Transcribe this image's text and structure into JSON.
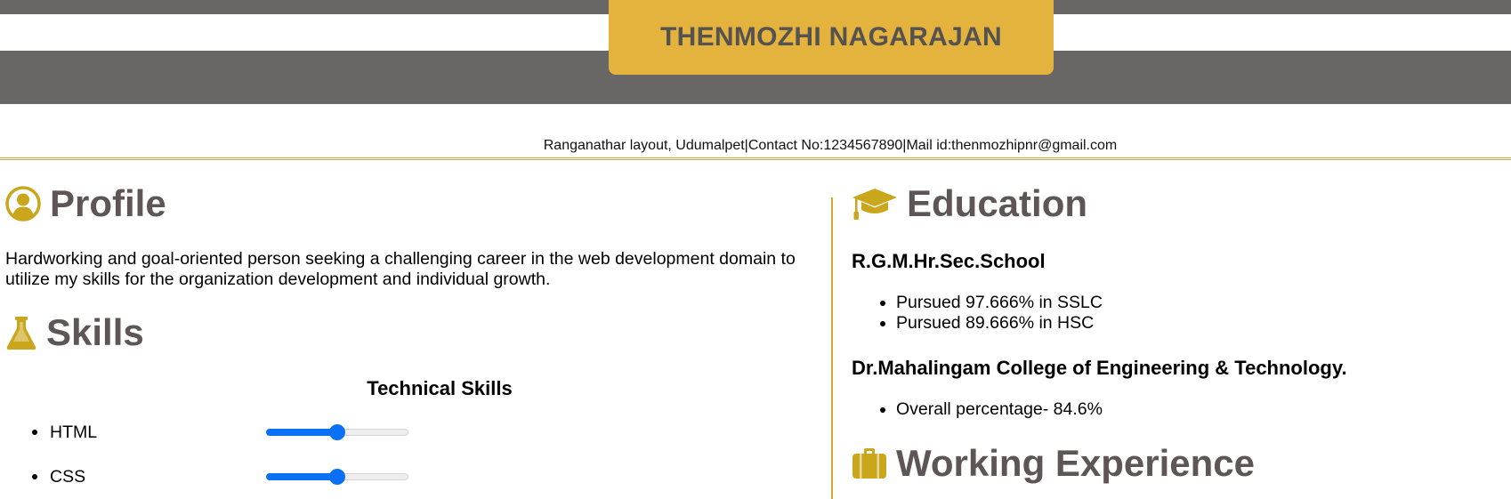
{
  "header": {
    "name": "THENMOZHI NAGARAJAN",
    "contact": "Ranganathar layout, Udumalpet|Contact No:1234567890|Mail id:thenmozhipnr@gmail.com"
  },
  "profile": {
    "icon": "user-circle-icon",
    "title": "Profile",
    "text": "Hardworking and goal-oriented person seeking a challenging career in the web development domain to utilize my skills for the organization development and individual growth."
  },
  "skills": {
    "icon": "flask-icon",
    "title": "Skills",
    "subtitle": "Technical Skills",
    "items": [
      {
        "label": "HTML",
        "level": 50
      },
      {
        "label": "CSS",
        "level": 50
      }
    ]
  },
  "education": {
    "icon": "graduation-cap-icon",
    "title": "Education",
    "schools": [
      {
        "name": "R.G.M.Hr.Sec.School",
        "points": [
          "Pursued 97.666% in SSLC",
          "Pursued 89.666% in HSC"
        ]
      },
      {
        "name": "Dr.Mahalingam College of Engineering & Technology.",
        "points": [
          "Overall percentage- 84.6%"
        ]
      }
    ]
  },
  "experience": {
    "icon": "briefcase-icon",
    "title": "Working Experience"
  },
  "colors": {
    "header_band": "#686766",
    "name_box": "#e4b33d",
    "accent_icon": "#c9a61b",
    "heading_text": "#5e5656",
    "slider": "#0a70f5"
  }
}
